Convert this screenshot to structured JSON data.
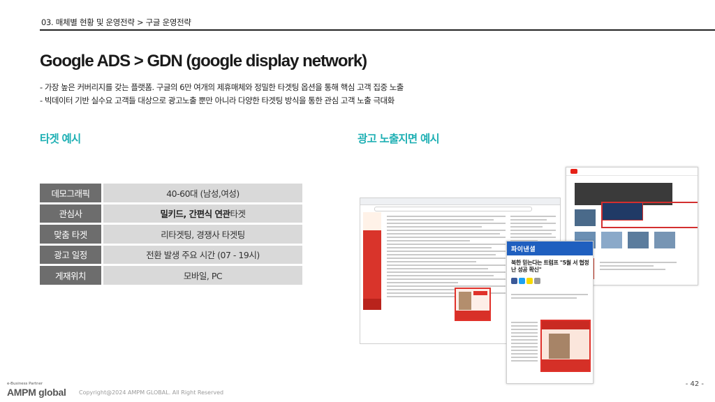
{
  "header": {
    "breadcrumb": "03. 매체별 현황 및 운영전략 > 구글 운영전략"
  },
  "title": "Google ADS > GDN (google display network)",
  "bullets": [
    "가장 높은 커버리지를 갖는 플랫폼. 구글의 6만 여개의 제휴매체와 정밀한 타겟팅 옵션을 통해 핵심 고객 집중 노출",
    "빅데이터 기반 실수요 고객들 대상으로 광고노출 뿐만 아니라 다양한 타겟팅 방식을 통한 관심 고객 노출 극대화"
  ],
  "sections": {
    "target_heading": "타겟 예시",
    "ad_heading": "광고 노출지면 예시"
  },
  "target_table": [
    {
      "label": "데모그래픽",
      "value_bold": "",
      "value": "40-60대 (남성,여성)"
    },
    {
      "label": "관심사",
      "value_bold": "밀키드, 간편식 연관",
      "value": " 타겟"
    },
    {
      "label": "맞춤 타겟",
      "value_bold": "",
      "value": "리타겟팅, 경쟁사 타겟팅"
    },
    {
      "label": "광고 일정",
      "value_bold": "",
      "value": "전환 발생 주요 시간 (07 - 19시)"
    },
    {
      "label": "게재위치",
      "value_bold": "",
      "value": "모바일, PC"
    }
  ],
  "mockups": {
    "news_brand": "파이낸셜",
    "news_title": "북한 믿는다는 트럼프 \"5월 서 협정난 성공 확신\"",
    "colors": {
      "ad_red": "#e0312a",
      "news_blue": "#1f5fbf",
      "youtube_red": "#e62117"
    }
  },
  "footer": {
    "partner_label": "e-Business Partner",
    "logo_text": "AMPM global",
    "copyright": "Copyright@2024 AMPM GLOBAL. All Right Reserved",
    "page_number": "- 42 -"
  },
  "colors": {
    "accent_teal": "#1fb0b4",
    "label_gray": "#6d6d6d",
    "value_gray": "#d9d9d9"
  }
}
